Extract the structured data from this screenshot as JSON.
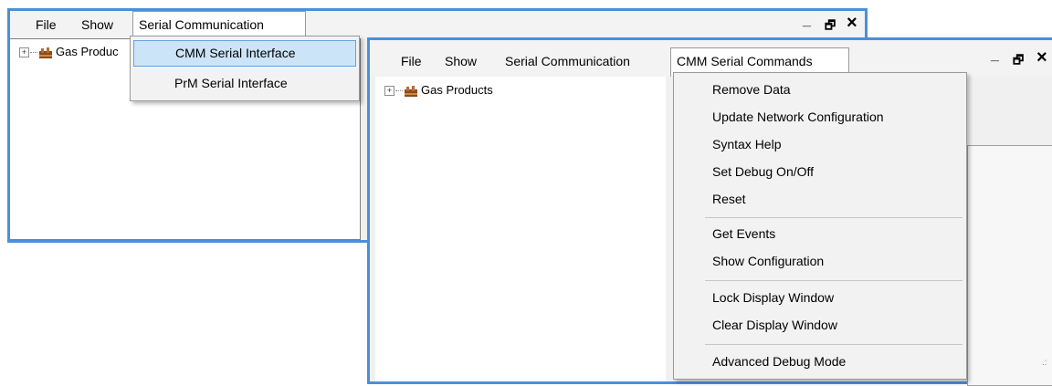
{
  "back_window": {
    "menu": {
      "file": "File",
      "show": "Show",
      "serial_communication": "Serial Communication"
    },
    "controls": {
      "minimize": "_",
      "restore": "🗗",
      "close": "×"
    },
    "tree": {
      "root_label": "Gas Produc"
    },
    "serial_dropdown": {
      "items": [
        "CMM Serial Interface",
        "PrM Serial Interface"
      ]
    }
  },
  "front_window": {
    "menu": {
      "file": "File",
      "show": "Show",
      "serial_communication": "Serial Communication",
      "cmm_serial_commands": "CMM Serial Commands"
    },
    "controls": {
      "minimize": "_",
      "restore": "🗗",
      "close": "×"
    },
    "tree": {
      "root_label": "Gas Products"
    },
    "cmm_dropdown": {
      "group1": [
        "Remove Data",
        "Update Network Configuration",
        "Syntax Help",
        "Set Debug On/Off",
        "Reset"
      ],
      "group2": [
        "Get Events",
        "Show Configuration"
      ],
      "group3": [
        "Lock Display Window",
        "Clear Display Window"
      ],
      "group4": [
        "Advanced Debug Mode"
      ]
    }
  },
  "icons": {
    "expander": "plus-box-icon",
    "gas": "gas-products-icon"
  },
  "colors": {
    "window_border": "#4a90d9",
    "highlight": "#cce4f7",
    "highlight_border": "#62a2e4"
  }
}
